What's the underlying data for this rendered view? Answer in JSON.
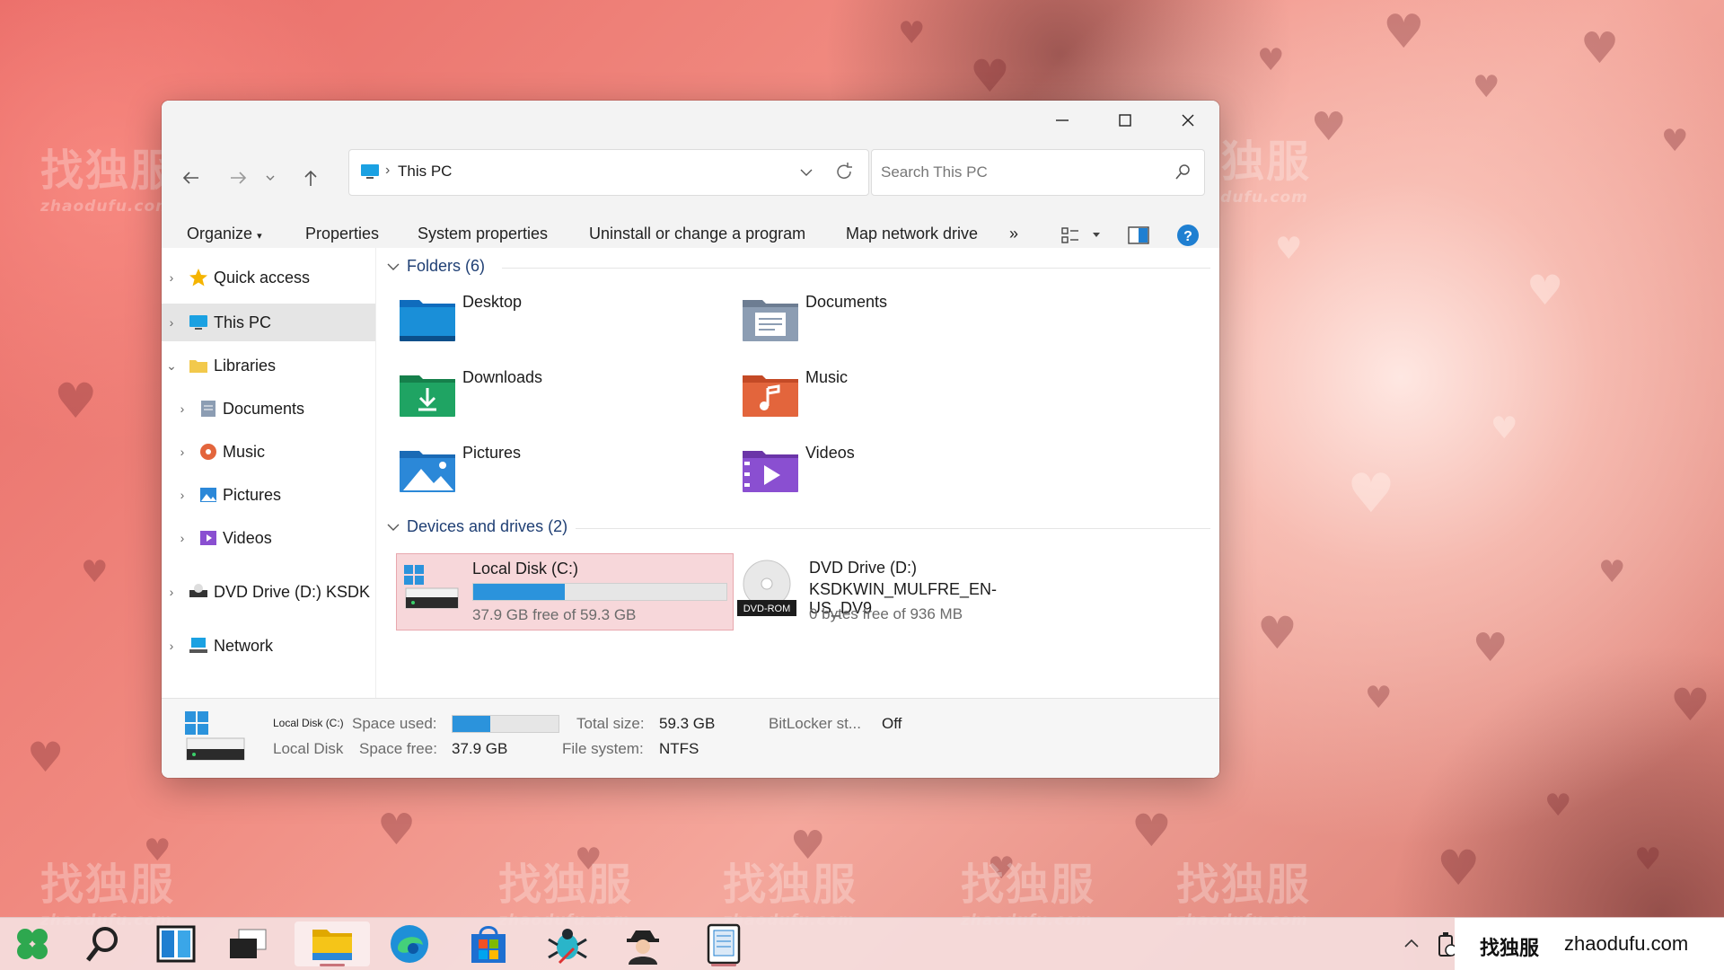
{
  "window": {
    "address": {
      "location": "This PC"
    },
    "search_placeholder": "Search This PC",
    "toolbar": {
      "organize": "Organize",
      "properties": "Properties",
      "system_properties": "System properties",
      "uninstall": "Uninstall or change a program",
      "map_drive": "Map network drive",
      "more": "»"
    },
    "sidebar": [
      {
        "label": "Quick access",
        "icon": "star-icon"
      },
      {
        "label": "This PC",
        "icon": "monitor-icon",
        "selected": true
      },
      {
        "label": "Libraries",
        "icon": "folder-icon",
        "expanded": true
      },
      {
        "label": "Documents",
        "icon": "documents-icon"
      },
      {
        "label": "Music",
        "icon": "music-icon"
      },
      {
        "label": "Pictures",
        "icon": "pictures-icon"
      },
      {
        "label": "Videos",
        "icon": "videos-icon"
      },
      {
        "label": "DVD Drive (D:) KSDK",
        "icon": "dvd-icon"
      },
      {
        "label": "Network",
        "icon": "network-icon"
      }
    ],
    "folders_header": "Folders (6)",
    "folders": [
      {
        "name": "Desktop",
        "color": "#1a8fd8"
      },
      {
        "name": "Documents",
        "color": "#8c9db3"
      },
      {
        "name": "Downloads",
        "color": "#1fa463"
      },
      {
        "name": "Music",
        "color": "#e3653c"
      },
      {
        "name": "Pictures",
        "color": "#2b88d8"
      },
      {
        "name": "Videos",
        "color": "#8a4fd1"
      }
    ],
    "drives_header": "Devices and drives (2)",
    "drives": [
      {
        "name": "Local Disk (C:)",
        "free_text": "37.9 GB free of 59.3 GB",
        "used_fraction": 0.36
      },
      {
        "name": "DVD Drive (D:)",
        "label": "KSDKWIN_MULFRE_EN-US_DV9",
        "free_text": "0 bytes free of 936 MB",
        "badge": "DVD-ROM"
      }
    ],
    "details": {
      "title": "Local Disk (C:)",
      "subtitle": "Local Disk",
      "space_used_label": "Space used:",
      "space_used_fraction": 0.36,
      "space_free_label": "Space free:",
      "space_free_value": "37.9 GB",
      "total_size_label": "Total size:",
      "total_size_value": "59.3 GB",
      "file_system_label": "File system:",
      "file_system_value": "NTFS",
      "bitlocker_label": "BitLocker st...",
      "bitlocker_value": "Off"
    }
  },
  "watermarks": {
    "cn": "找独服",
    "en": "zhaodufu.com"
  },
  "taskbar": {
    "items": [
      "start-icon",
      "search-icon",
      "widgets-icon",
      "task-view-icon",
      "file-explorer-icon",
      "edge-icon",
      "store-icon",
      "bug-app-icon",
      "agent-app-icon",
      "reader-app-icon"
    ],
    "tray_text_cn": "找独服",
    "tray_text": "zhaodufu.com"
  },
  "accent": "#2b93dc"
}
